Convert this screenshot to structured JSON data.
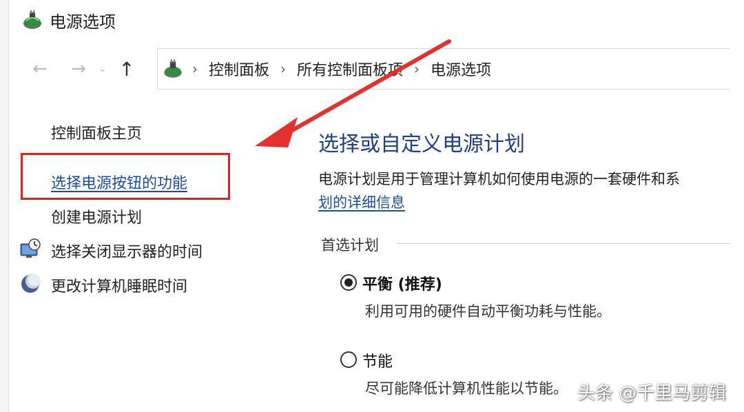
{
  "window": {
    "title": "电源选项"
  },
  "nav": {
    "back_icon": "back-arrow-icon",
    "forward_icon": "forward-arrow-icon",
    "dropdown_icon": "chevron-down-icon",
    "up_icon": "up-arrow-icon"
  },
  "breadcrumb": {
    "items": [
      "控制面板",
      "所有控制面板项",
      "电源选项"
    ],
    "separator": "›"
  },
  "sidebar": {
    "home": "控制面板主页",
    "links": [
      {
        "label": "选择电源按钮的功能",
        "highlighted": true
      },
      {
        "label": "创建电源计划",
        "icon": ""
      },
      {
        "label": "选择关闭显示器的时间",
        "icon": "monitor-clock-icon"
      },
      {
        "label": "更改计算机睡眠时间",
        "icon": "moon-icon"
      }
    ]
  },
  "main": {
    "title": "选择或自定义电源计划",
    "description": "电源计划是用于管理计算机如何使用电源的一套硬件和系",
    "description_link": "划的详细信息",
    "section_label": "首选计划",
    "plans": [
      {
        "name": "平衡 (推荐)",
        "description": "利用可用的硬件自动平衡功耗与性能。",
        "selected": true
      },
      {
        "name": "节能",
        "description": "尽可能降低计算机性能以节能。",
        "selected": false
      }
    ]
  },
  "watermark": "头条 @千里马剪辑",
  "colors": {
    "link": "#1a4da8",
    "title": "#1f3f8a",
    "annotation_red": "#e02020"
  }
}
